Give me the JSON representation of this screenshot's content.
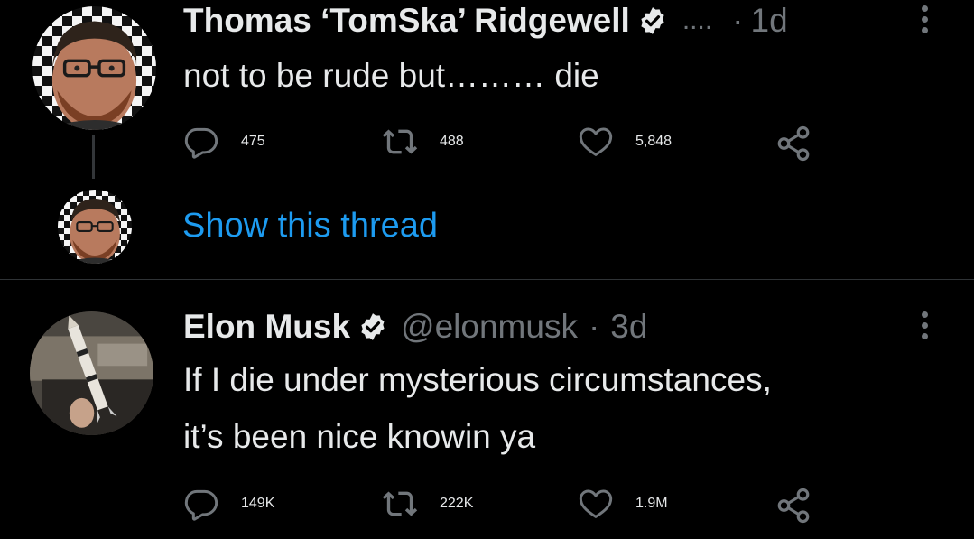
{
  "tweets": [
    {
      "author_name": "Thomas ‘TomSka’ Ridgewell",
      "verified": true,
      "handle_truncated": "....",
      "separator": "·",
      "time": "1d",
      "text": "not to be rude but……… die",
      "stats": {
        "replies": "475",
        "retweets": "488",
        "likes": "5,848"
      },
      "show_thread_label": "Show this thread"
    },
    {
      "author_name": "Elon Musk",
      "verified": true,
      "handle": "@elonmusk",
      "separator": "·",
      "time": "3d",
      "text_lines": [
        "If I die under mysterious circumstances,",
        "it’s been nice knowin ya"
      ],
      "stats": {
        "replies": "149K",
        "retweets": "222K",
        "likes": "1.9M"
      }
    }
  ],
  "icons": {
    "reply": "reply-icon",
    "retweet": "retweet-icon",
    "like": "heart-icon",
    "share": "share-icon",
    "verified": "verified-badge-icon",
    "more": "more-options-icon"
  },
  "colors": {
    "background": "#000000",
    "text_primary": "#e7e9ea",
    "text_muted": "#71767b",
    "link": "#1d9bf0",
    "divider": "#2f3336"
  }
}
